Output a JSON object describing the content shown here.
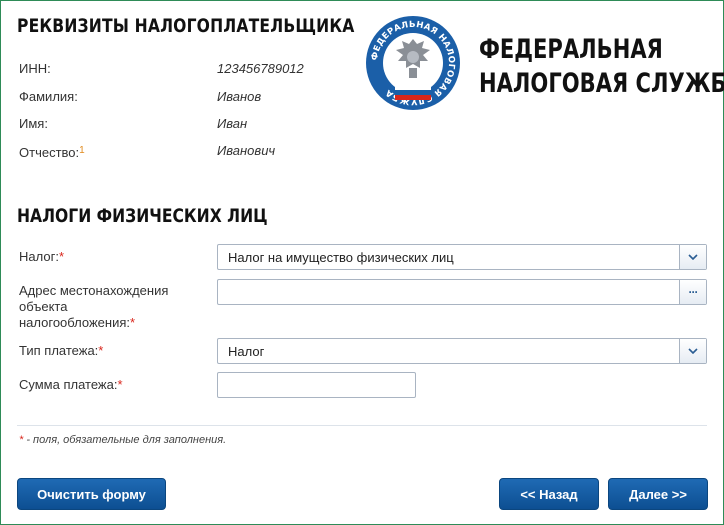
{
  "taxpayer": {
    "title": "РЕКВИЗИТЫ НАЛОГОПЛАТЕЛЬЩИКА",
    "inn_label": "ИНН:",
    "inn_value": "123456789012",
    "surname_label": "Фамилия:",
    "surname_value": "Иванов",
    "name_label": "Имя:",
    "name_value": "Иван",
    "patronymic_label": "Отчество:",
    "patronymic_footnote": "1",
    "patronymic_value": "Иванович"
  },
  "logo": {
    "ring_text": "ФЕДЕРАЛЬНАЯ НАЛОГОВАЯ СЛУЖБА",
    "title_line1": "ФЕДЕРАЛЬНАЯ",
    "title_line2": "НАЛОГОВАЯ СЛУЖБА"
  },
  "taxes": {
    "title": "НАЛОГИ ФИЗИЧЕСКИХ ЛИЦ",
    "required_mark": "*",
    "tax_label": "Налог:",
    "tax_value": "Налог на имущество физических лиц",
    "address_label_1": "Адрес местонахождения",
    "address_label_2": "объекта",
    "address_label_3": "налогообложения:",
    "address_value": "",
    "address_button": "···",
    "payment_type_label": "Тип платежа:",
    "payment_type_value": "Налог",
    "amount_label": "Сумма платежа:",
    "amount_value": ""
  },
  "note": {
    "mark": "*",
    "text": " - поля, обязательные для заполнения."
  },
  "buttons": {
    "clear": "Очистить форму",
    "back": "<< Назад",
    "next": "Далее >>"
  },
  "colors": {
    "button": "#1460a8",
    "required": "#d9261c",
    "footnote": "#e08a1e",
    "logo_blue": "#1b5fa8"
  }
}
